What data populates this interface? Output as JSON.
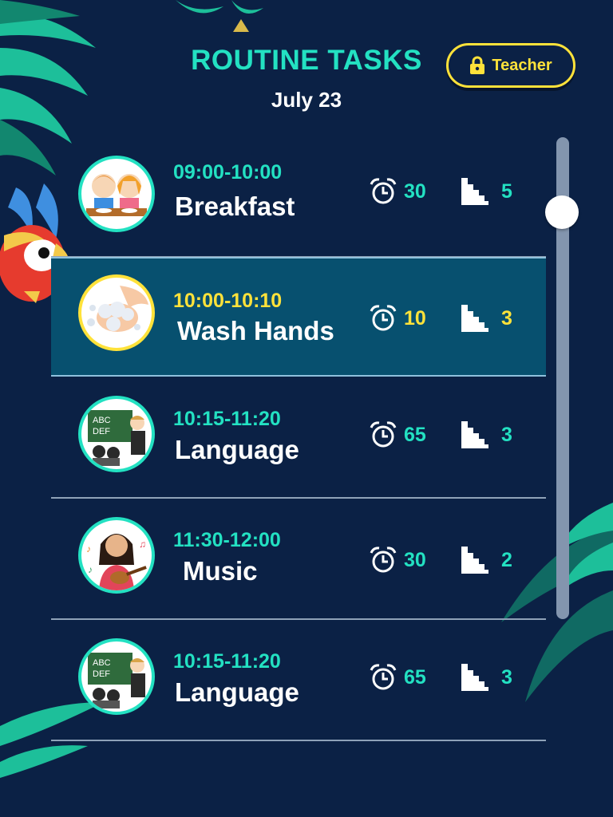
{
  "header": {
    "title": "ROUTINE TASKS",
    "date": "July 23",
    "teacher_button_label": "Teacher",
    "teacher_button_icon": "lock-icon"
  },
  "colors": {
    "background": "#0b2145",
    "accent": "#23e1c2",
    "highlight": "#ffe23a",
    "selected_row": "#07506f"
  },
  "tasks": [
    {
      "time": "09:00-10:00",
      "name": "Breakfast",
      "duration": "30",
      "steps": "5",
      "image": "children-eating-breakfast",
      "selected": false
    },
    {
      "time": "10:00-10:10",
      "name": "Wash Hands",
      "duration": "10",
      "steps": "3",
      "image": "soapy-hands",
      "selected": true
    },
    {
      "time": "10:15-11:20",
      "name": "Language",
      "duration": "65",
      "steps": "3",
      "image": "teacher-at-blackboard",
      "selected": false
    },
    {
      "time": "11:30-12:00",
      "name": "Music",
      "duration": "30",
      "steps": "2",
      "image": "girl-playing-ukulele",
      "selected": false
    },
    {
      "time": "10:15-11:20",
      "name": "Language",
      "duration": "65",
      "steps": "3",
      "image": "teacher-at-blackboard",
      "selected": false
    }
  ],
  "icons": {
    "duration": "alarm-clock-icon",
    "steps": "stairs-icon"
  },
  "scroll": {
    "position_fraction": 0.13
  }
}
